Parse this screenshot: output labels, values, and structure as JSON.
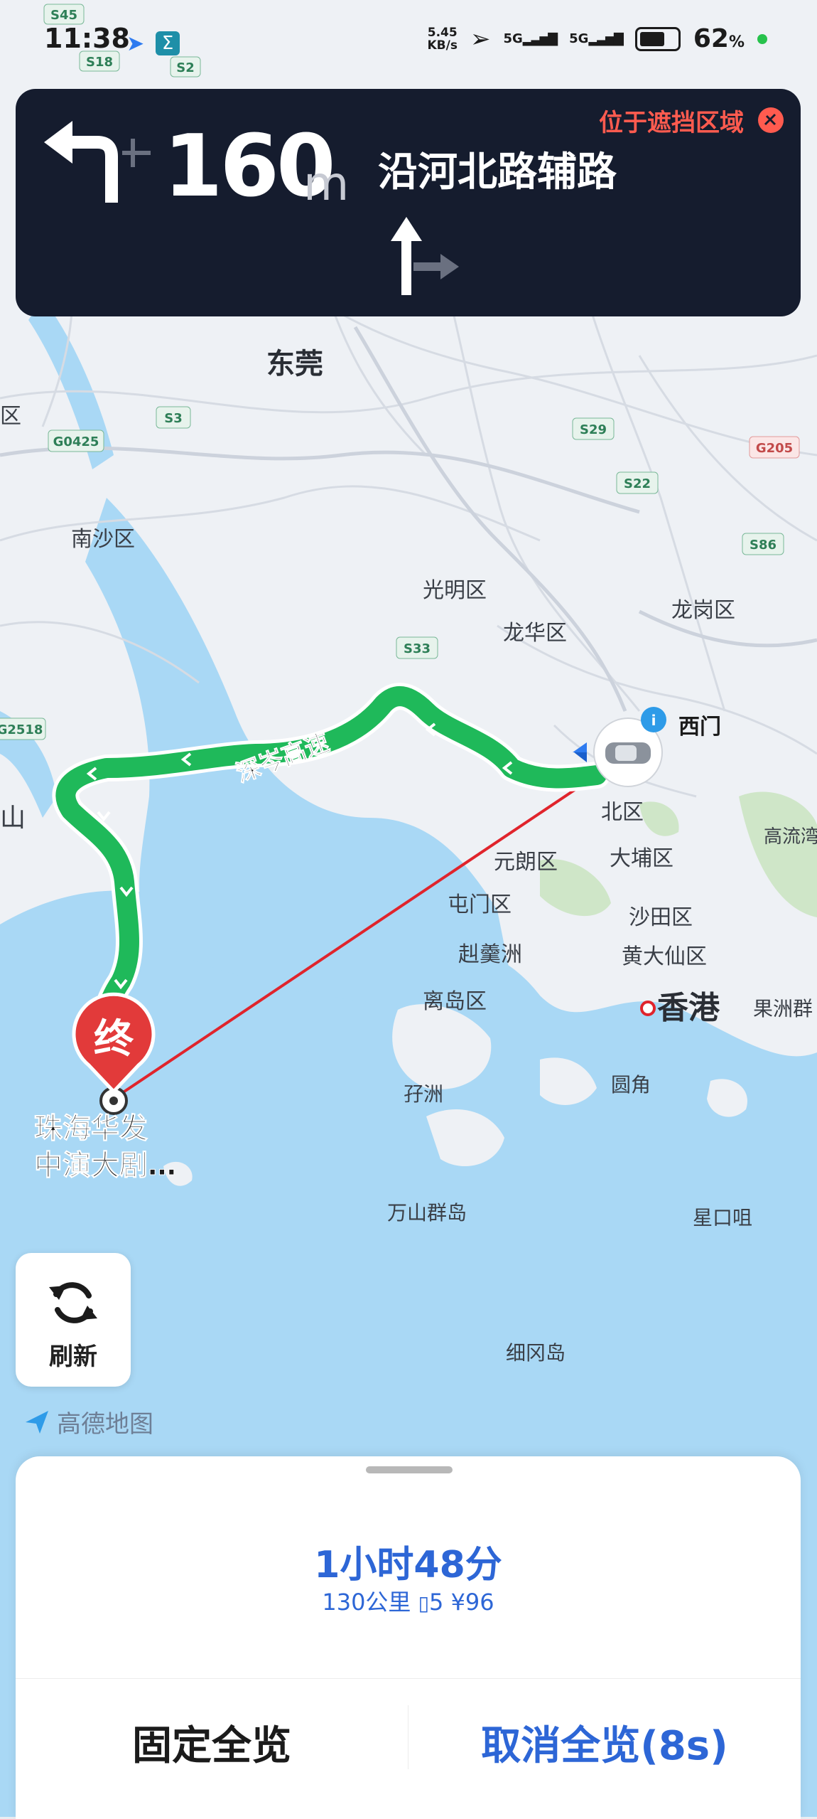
{
  "status_bar": {
    "time": "11:38",
    "speed_value": "5.45",
    "speed_unit": "KB/s",
    "network_1": "5G",
    "network_2": "5G",
    "battery": "62",
    "battery_unit": "%"
  },
  "navigation": {
    "distance": "160",
    "distance_unit": "m",
    "road_name": "沿河北路辅路",
    "occlusion_warning": "位于遮挡区域",
    "maneuver_icon": "turn-left-icon",
    "lane_icon": "lane-straight-right-icon"
  },
  "map": {
    "route_name": "深岑高速",
    "destination_marker": "终",
    "destination_name_line1": "珠海华发",
    "destination_name_line2": "中演大剧…",
    "poi_ximen": "西门",
    "places": {
      "dongguan": "东莞",
      "nansha": "南沙区",
      "guangming": "光明区",
      "longhua": "龙华区",
      "longgang": "龙岗区",
      "beiqu": "北区",
      "dabu": "大埔区",
      "yuanlang": "元朗区",
      "tunmen": "屯门区",
      "shatian": "沙田区",
      "huangdaxian": "黄大仙区",
      "kuichong": "赳羹洲",
      "lidao": "离岛区",
      "xianggang": "香港",
      "guozhou": "果洲群",
      "gaoliu": "高流湾",
      "yuzhou": "孖洲",
      "yuanjiao": "圆角",
      "wanshan": "万山群岛",
      "xingkouju": "星口咀",
      "xigang": "细冈岛",
      "shan": "山",
      "qu_left": "区"
    },
    "road_shields": [
      "S45",
      "S18",
      "S2",
      "G0425",
      "S3",
      "S29",
      "S22",
      "G205",
      "S86",
      "S33",
      "G2518"
    ],
    "colors": {
      "route": "#1fb95a",
      "route_edge": "#ffffff",
      "line_to_destination": "#e0242c",
      "water": "#a9d8f5",
      "land": "#eef1f5"
    }
  },
  "controls": {
    "refresh_label": "刷新",
    "refresh_icon": "refresh-icon",
    "logo_text": "高德地图"
  },
  "panel": {
    "eta": "1小时48分",
    "distance": "130公里",
    "traffic_lights": "5",
    "toll": "¥96",
    "fixed_overview": "固定全览",
    "cancel_overview": "取消全览(8s)"
  }
}
